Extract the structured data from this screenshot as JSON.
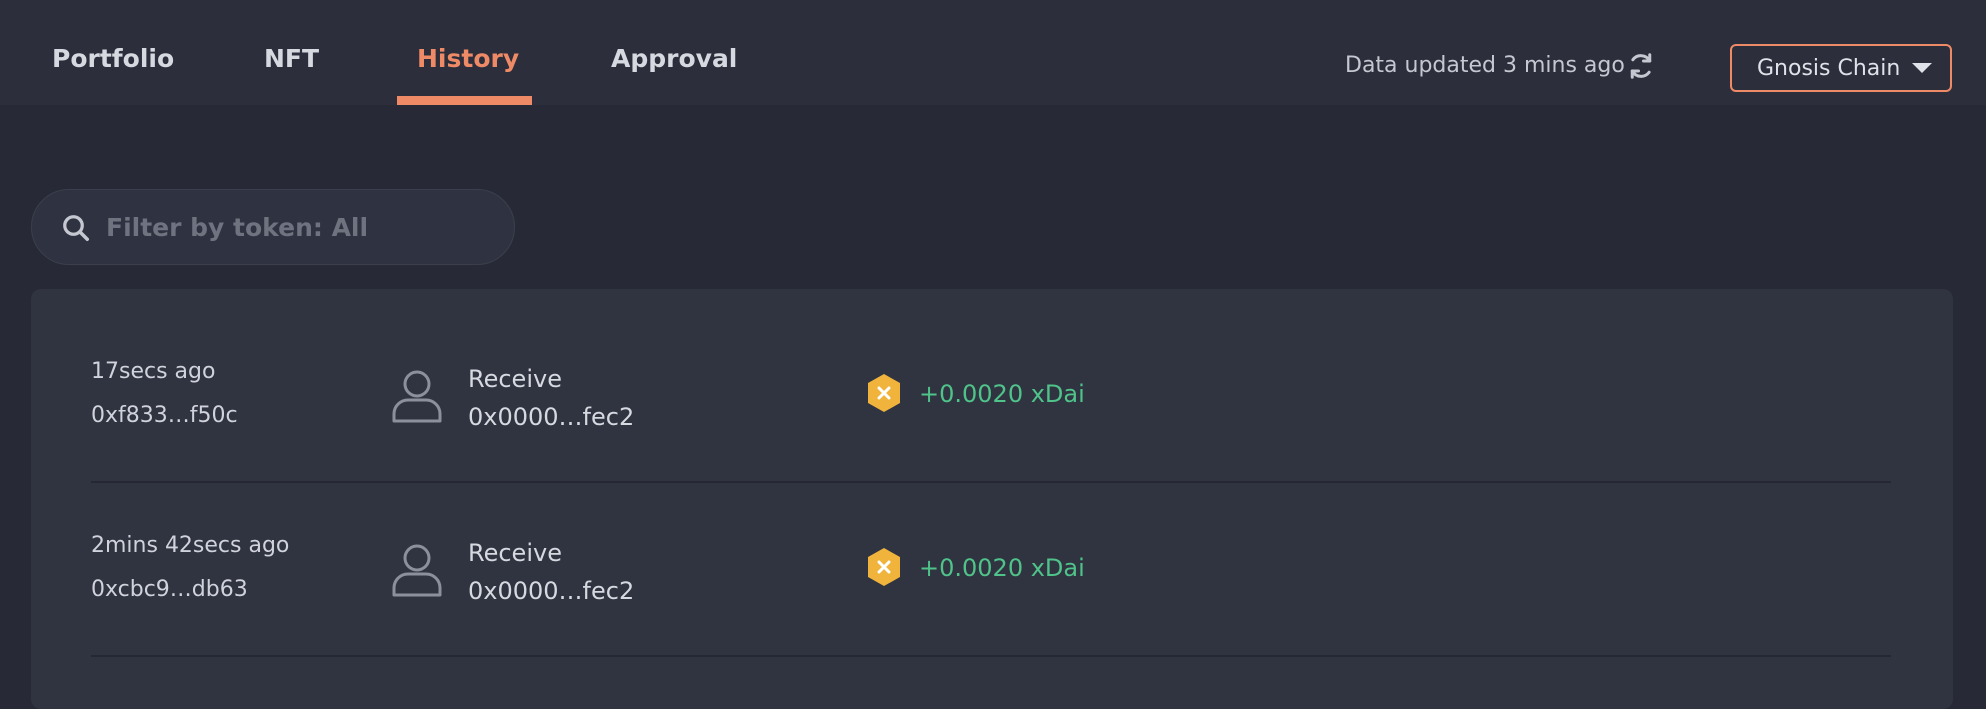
{
  "tabs": [
    {
      "label": "Portfolio",
      "active": false
    },
    {
      "label": "NFT",
      "active": false
    },
    {
      "label": "History",
      "active": true
    },
    {
      "label": "Approval",
      "active": false
    }
  ],
  "header": {
    "updated_text": "Data updated 3 mins ago",
    "chain_selector": "Gnosis Chain"
  },
  "search": {
    "placeholder": "Filter by token: All",
    "value": ""
  },
  "history": [
    {
      "time": "17secs ago",
      "hash": "0xf833…f50c",
      "type": "Receive",
      "address": "0x0000…fec2",
      "amount": "+0.0020 xDai"
    },
    {
      "time": "2mins 42secs ago",
      "hash": "0xcbc9…db63",
      "type": "Receive",
      "address": "0x0000…fec2",
      "amount": "+0.0020 xDai"
    }
  ],
  "colors": {
    "accent": "#ef8a67",
    "positive": "#4fc38a",
    "token_badge": "#f0b43c",
    "background": "#272a36",
    "panel": "#303340"
  },
  "icons": {
    "refresh": "refresh-icon",
    "search": "search-icon",
    "caret": "caret-down-icon",
    "avatar": "user-icon",
    "token": "xdai-token-icon"
  }
}
